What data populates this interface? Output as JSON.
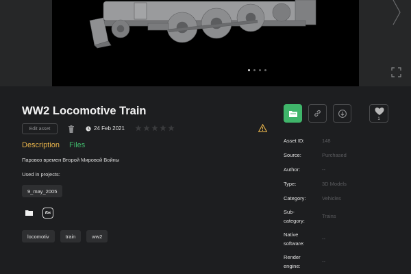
{
  "asset": {
    "title": "WW2 Locomotive Train",
    "edit_label": "Edit asset",
    "date": "24 Feb 2021",
    "description": "Паровоз времен Второй Мировой Войны",
    "used_in_label": "Used in projects:",
    "projects": [
      "9_may_2005"
    ],
    "format_badge": "fbx",
    "tags": [
      "locomotiv",
      "train",
      "ww2"
    ],
    "rating": 0,
    "rating_max": 5,
    "likes": "1"
  },
  "tabs": {
    "description": "Description",
    "files": "Files"
  },
  "carousel": {
    "slides": 4,
    "active_slide": 1
  },
  "details": {
    "asset_id_label": "Asset ID:",
    "asset_id": "148",
    "source_label": "Source:",
    "source": "Purchased",
    "author_label": "Author:",
    "author": "--",
    "type_label": "Type:",
    "type": "3D Models",
    "category_label": "Category:",
    "category": "Vehicles",
    "subcategory_label_1": "Sub-",
    "subcategory_label_2": "category:",
    "subcategory": "Trains",
    "native_label_1": "Native",
    "native_label_2": "software:",
    "native": "--",
    "render_label_1": "Render",
    "render_label_2": "engine:",
    "render": "--"
  },
  "colors": {
    "accent_green": "#3fb56a",
    "accent_orange": "#e6b24a",
    "background": "#1d1e20"
  }
}
